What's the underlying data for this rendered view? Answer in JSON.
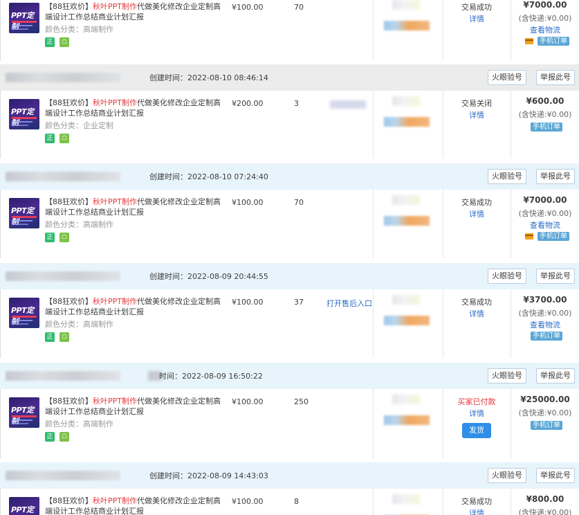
{
  "labels": {
    "aftersale_entry": "打开售后入口",
    "detail": "详情",
    "view_logistics": "查看物流",
    "mobile_order": "手机订单",
    "ship": "发货",
    "huoyan": "火眼验号",
    "report": "举报此号",
    "badge_genuine": "正",
    "thumb_text": "PPT定制"
  },
  "product": {
    "title_prefix": "【88狂欢价】",
    "title_brand": "秋叶PPT制作",
    "title_rest": "代做美化修改企业定制高端设计工作总结商业计划汇报"
  },
  "orders": [
    {
      "created": "",
      "price": "¥100.00",
      "qty": "70",
      "variant": "颜色分类：高端制作",
      "status": "交易成功",
      "total": "¥7000.00",
      "shipping": "(含快递:¥0.00)"
    },
    {
      "created": "创建时间：2022-08-10 08:46:14",
      "price": "¥200.00",
      "qty": "3",
      "variant": "颜色分类：企业定制",
      "status": "交易关闭",
      "total": "¥600.00",
      "shipping": "(含快递:¥0.00)"
    },
    {
      "created": "创建时间：2022-08-10 07:24:40",
      "price": "¥100.00",
      "qty": "70",
      "variant": "颜色分类：高端制作",
      "status": "交易成功",
      "total": "¥7000.00",
      "shipping": "(含快递:¥0.00)"
    },
    {
      "created": "创建时间：2022-08-09 20:44:55",
      "price": "¥100.00",
      "qty": "37",
      "variant": "颜色分类：高端制作",
      "status": "交易成功",
      "total": "¥3700.00",
      "shipping": "(含快递:¥0.00)"
    },
    {
      "created": "时间：2022-08-09 16:50:22",
      "price": "¥100.00",
      "qty": "250",
      "variant": "颜色分类：高端制作",
      "status": "买家已付款",
      "total": "¥25000.00",
      "shipping": "(含快递:¥0.00)"
    },
    {
      "created": "创建时间：2022-08-09 14:43:03",
      "price": "¥100.00",
      "qty": "8",
      "variant": "",
      "status": "交易成功",
      "total": "¥800.00",
      "shipping": "(含快递:¥0.00)"
    }
  ],
  "colors": {
    "header_gray": "#ececec",
    "header_blue": "#e8f4fb",
    "link_blue": "#2a6ac9",
    "price_red": "#e4393c",
    "ship_button": "#2f8ee6"
  },
  "icons": [
    "product-thumbnail",
    "genuine-badge-icon",
    "gift-badge-icon",
    "card-icon"
  ]
}
